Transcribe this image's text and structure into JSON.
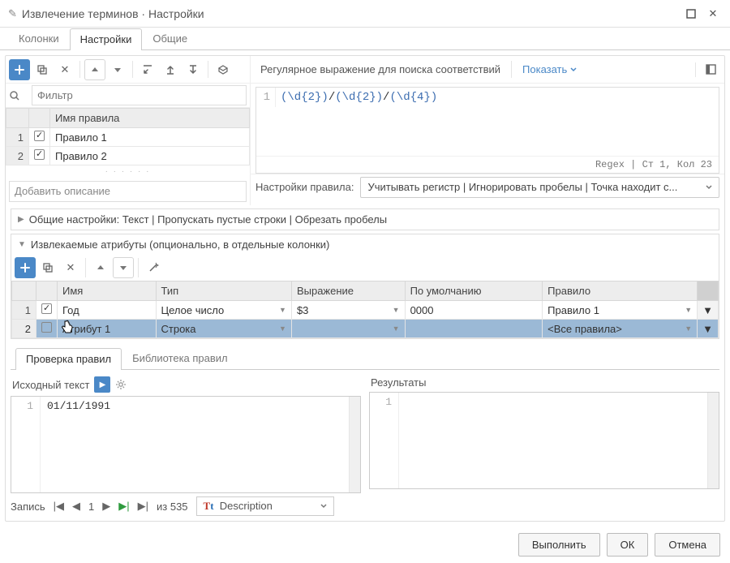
{
  "window": {
    "title": "Извлечение терминов · Настройки"
  },
  "top_tabs": {
    "columns": "Колонки",
    "settings": "Настройки",
    "general": "Общие"
  },
  "toolbar": {
    "show": "Показать",
    "regex_label": "Регулярное выражение для поиска соответствий"
  },
  "filter": {
    "placeholder": "Фильтр"
  },
  "rules_table": {
    "header": "Имя правила",
    "rows": [
      {
        "n": "1",
        "checked": true,
        "name": "Правило 1"
      },
      {
        "n": "2",
        "checked": true,
        "name": "Правило 2"
      }
    ]
  },
  "desc_placeholder": "Добавить описание",
  "regex": {
    "line_no": "1",
    "g1": "(\\d{2})",
    "sep1": "/",
    "g2": "(\\d{2})",
    "sep2": "/",
    "g3": "(\\d{4})",
    "status": "Regex | Ст 1, Кол 23"
  },
  "rule_settings": {
    "label": "Настройки правила:",
    "text": "Учитывать регистр | Игнорировать пробелы | Точка находит с..."
  },
  "section_general": "Общие настройки: Текст | Пропускать пустые строки | Обрезать пробелы",
  "section_attrs": "Извлекаемые атрибуты (опционально, в отдельные колонки)",
  "attrs_table": {
    "headers": {
      "name": "Имя",
      "type": "Тип",
      "expr": "Выражение",
      "def": "По умолчанию",
      "rule": "Правило"
    },
    "rows": [
      {
        "n": "1",
        "checked": true,
        "name": "Год",
        "type": "Целое число",
        "expr": "$3",
        "def": "0000",
        "rule": "Правило 1"
      },
      {
        "n": "2",
        "checked": false,
        "name": "Атрибут 1",
        "type": "Строка",
        "expr": "",
        "def": "",
        "rule": "<Все правила>"
      }
    ]
  },
  "lower_tabs": {
    "test": "Проверка правил",
    "lib": "Библиотека правил"
  },
  "test": {
    "left_title": "Исходный текст",
    "right_title": "Результаты",
    "left_line_no": "1",
    "left_text": "01/11/1991",
    "right_line_no": "1"
  },
  "pager": {
    "label": "Запись",
    "current": "1",
    "of": "из 535",
    "field": "Description"
  },
  "footer": {
    "run": "Выполнить",
    "ok": "ОК",
    "cancel": "Отмена"
  }
}
